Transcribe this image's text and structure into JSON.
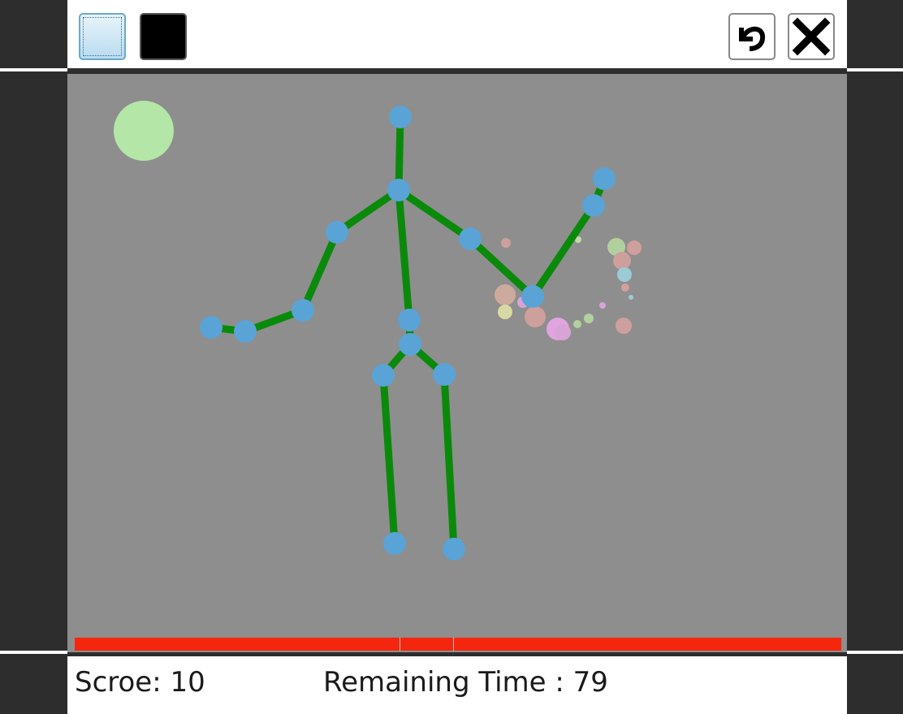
{
  "toolbar": {
    "light_mode_button": "light-mode-button",
    "dark_mode_button": "dark-mode-button",
    "undo_icon": "undo-arrow-icon",
    "close_icon": "close-x-icon"
  },
  "colors": {
    "canvas_bg": "#8e8e8e",
    "bone": "#0a8a0a",
    "joint": "#5aa3d6",
    "target": "#b4e6a8",
    "timer_bar": "#f5260e"
  },
  "game": {
    "target_ball": "target-ball",
    "skeleton": "stick-figure-skeleton",
    "particles": "sparkle-particles"
  },
  "timer": {
    "remaining_fraction": 1.0
  },
  "status": {
    "score_label": "Scroe",
    "score_sep": ": ",
    "score_value": "10",
    "time_label": "Remaining Time : ",
    "time_value": "79"
  }
}
